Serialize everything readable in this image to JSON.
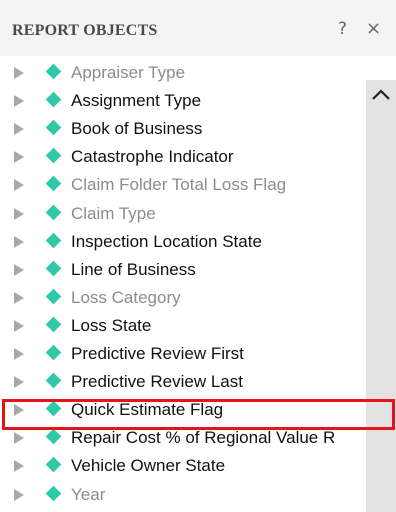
{
  "panel": {
    "title": "REPORT OBJECTS",
    "help_label": "?",
    "close_label": "×"
  },
  "colors": {
    "diamond": "#2ec9a8",
    "highlight": "#e5141b",
    "active_text": "#111111",
    "inactive_text": "#8c8c8c"
  },
  "items": [
    {
      "label": "Appraiser Type",
      "active": false
    },
    {
      "label": "Assignment Type",
      "active": true
    },
    {
      "label": "Book of Business",
      "active": true
    },
    {
      "label": "Catastrophe Indicator",
      "active": true
    },
    {
      "label": "Claim Folder Total Loss Flag",
      "active": false
    },
    {
      "label": "Claim Type",
      "active": false
    },
    {
      "label": "Inspection Location State",
      "active": true
    },
    {
      "label": "Line of Business",
      "active": true
    },
    {
      "label": "Loss Category",
      "active": false
    },
    {
      "label": "Loss State",
      "active": true
    },
    {
      "label": "Predictive Review First",
      "active": true
    },
    {
      "label": "Predictive Review Last",
      "active": true
    },
    {
      "label": "Quick Estimate Flag",
      "active": true,
      "highlighted": true
    },
    {
      "label": "Repair Cost % of Regional Value R",
      "active": true
    },
    {
      "label": "Vehicle Owner State",
      "active": true
    },
    {
      "label": "Year",
      "active": false
    }
  ]
}
